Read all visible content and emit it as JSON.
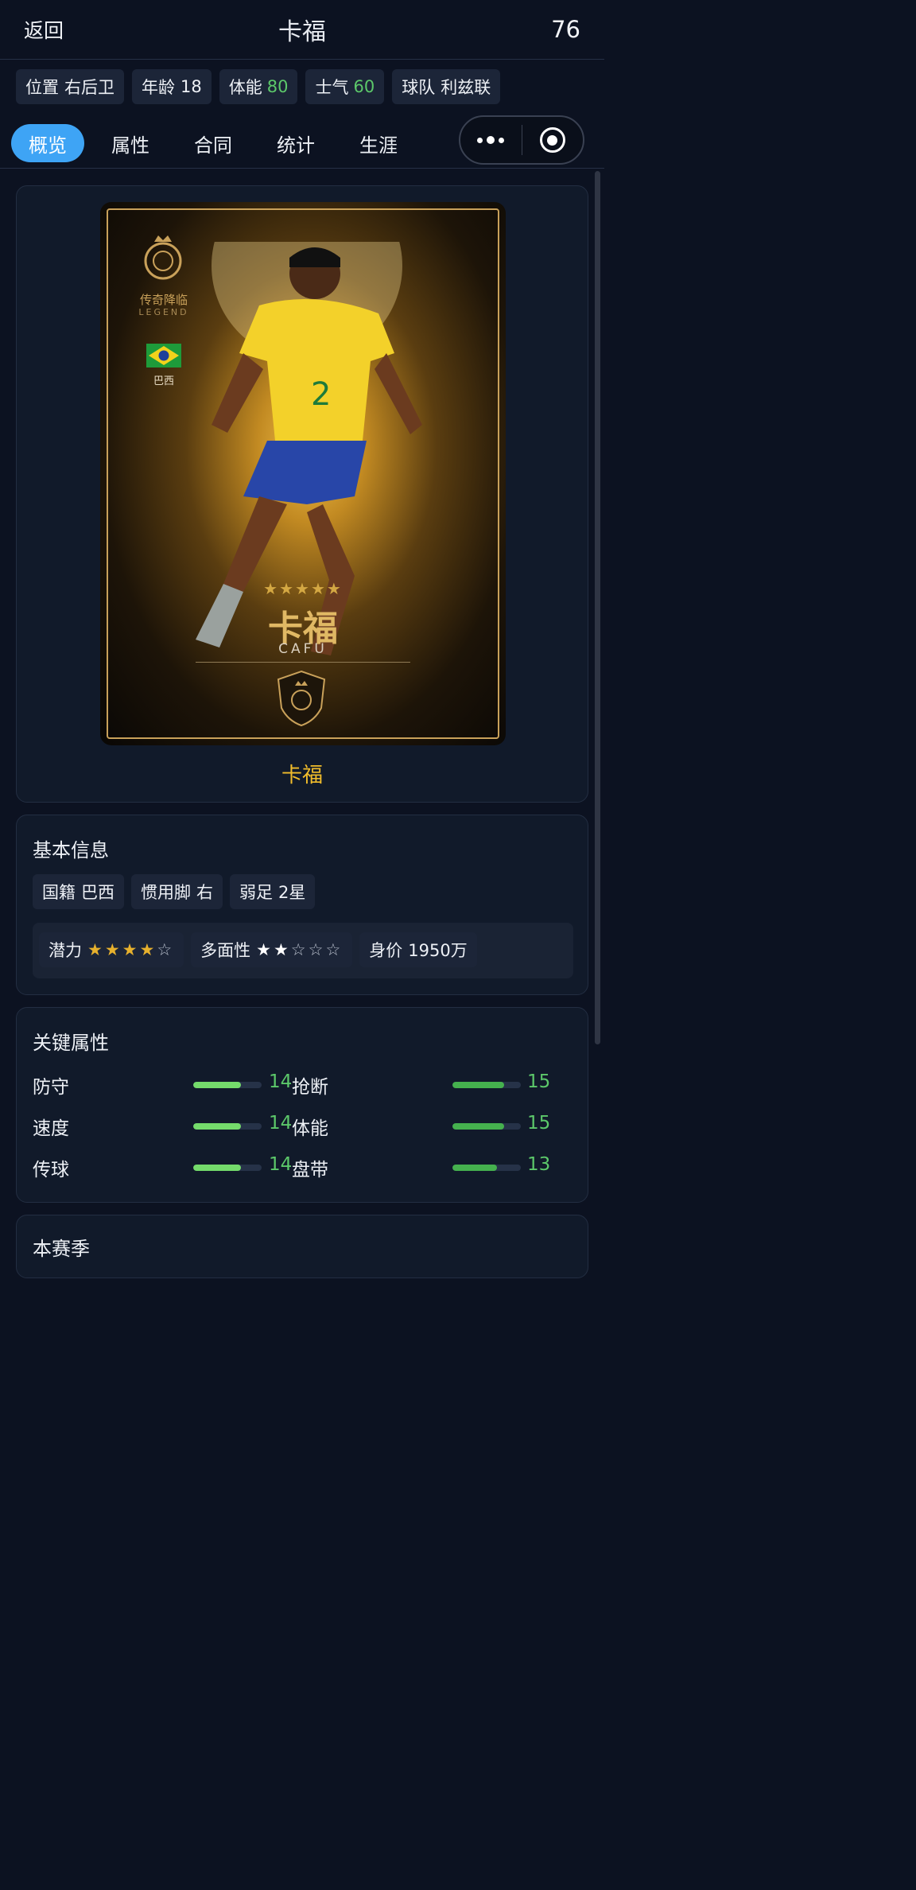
{
  "header": {
    "back_label": "返回",
    "title": "卡福",
    "rating": "76"
  },
  "chips": {
    "position": {
      "label": "位置",
      "value": "右后卫"
    },
    "age": {
      "label": "年龄",
      "value": "18"
    },
    "stamina": {
      "label": "体能",
      "value": "80"
    },
    "morale": {
      "label": "士气",
      "value": "60"
    },
    "team": {
      "label": "球队",
      "value": "利兹联"
    }
  },
  "tabs": [
    "概览",
    "属性",
    "合同",
    "统计",
    "生涯"
  ],
  "active_tab": 0,
  "card": {
    "crest_text": "传奇降临",
    "legend_text": "LEGEND",
    "flag_text": "巴西",
    "stars": "★★★★★",
    "name_cn": "卡福",
    "name_en": "CAFU",
    "caption": "卡福"
  },
  "basic_info": {
    "title": "基本信息",
    "nationality": {
      "label": "国籍",
      "value": "巴西"
    },
    "foot": {
      "label": "惯用脚",
      "value": "右"
    },
    "weak_foot": {
      "label": "弱足",
      "value": "2星"
    },
    "potential": {
      "label": "潜力",
      "stars_filled": 4,
      "stars_total": 5
    },
    "versatility": {
      "label": "多面性",
      "stars_filled": 2,
      "stars_total": 5
    },
    "value": {
      "label": "身价",
      "value": "1950万"
    }
  },
  "key_attributes": {
    "title": "关键属性",
    "max": 20,
    "left": [
      {
        "label": "防守",
        "value": 14
      },
      {
        "label": "速度",
        "value": 14
      },
      {
        "label": "传球",
        "value": 14
      }
    ],
    "right": [
      {
        "label": "抢断",
        "value": 15
      },
      {
        "label": "体能",
        "value": 15
      },
      {
        "label": "盘带",
        "value": 13
      }
    ]
  },
  "season": {
    "title": "本赛季"
  },
  "colors": {
    "accent": "#3ea4f5",
    "positive": "#5cc86a",
    "gold": "#f2bd2b"
  }
}
